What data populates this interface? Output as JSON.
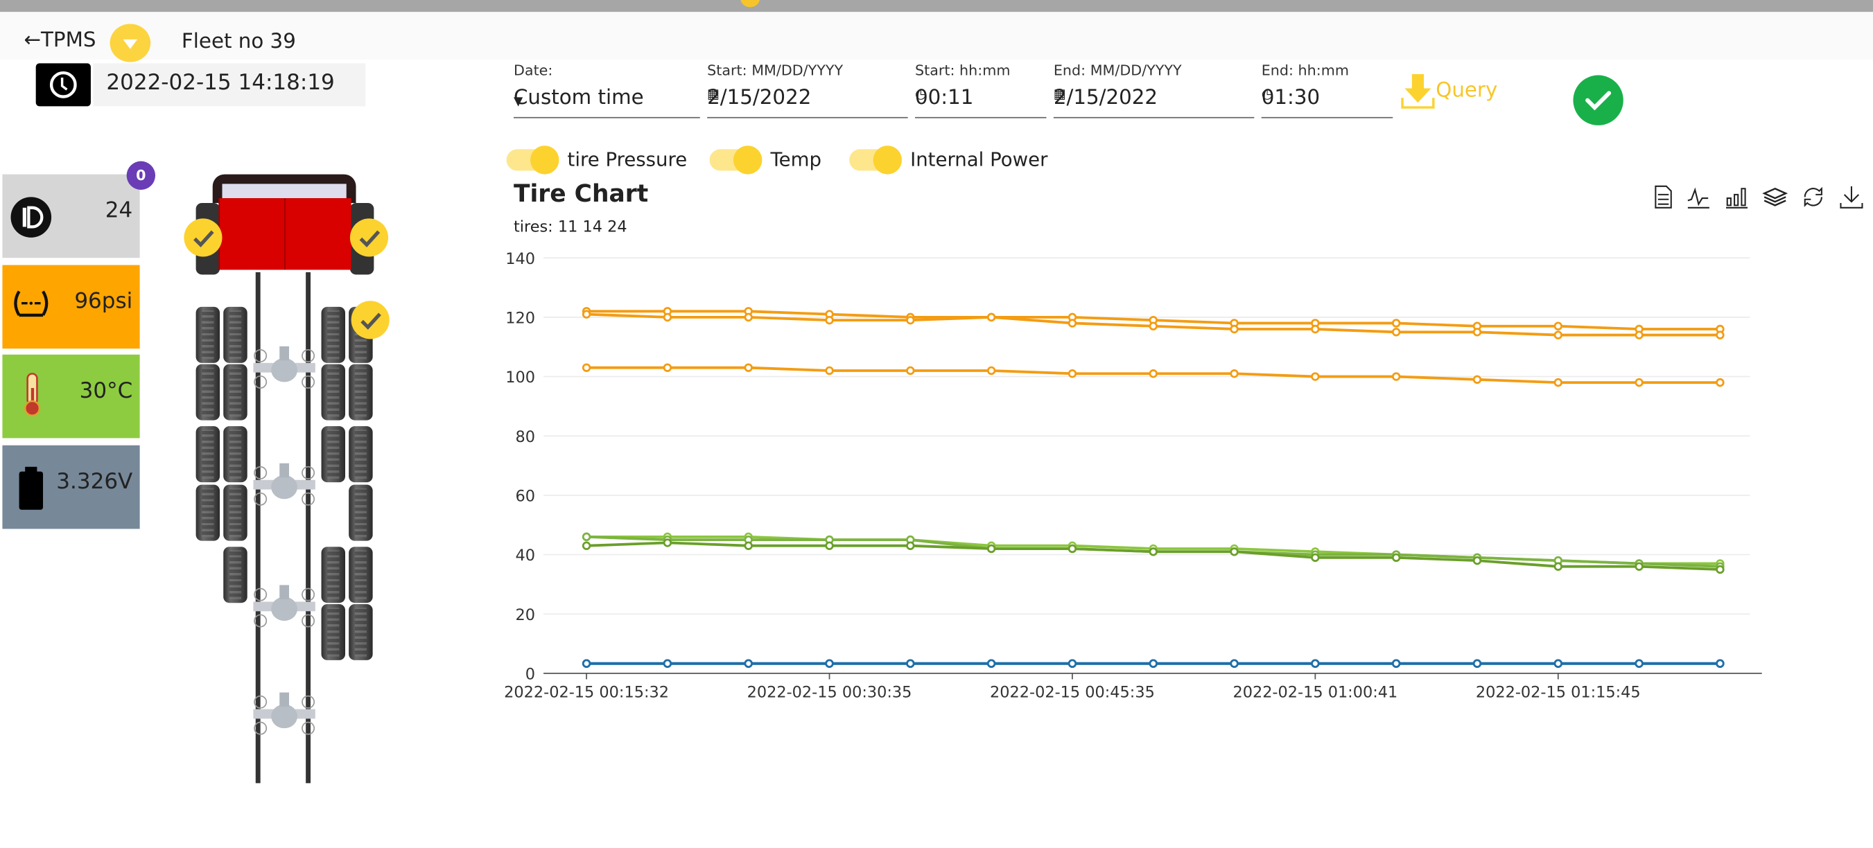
{
  "header": {
    "back_label": "TPMS",
    "fleet": "Fleet no 39",
    "datetime": "2022-02-15 14:18:19"
  },
  "sensor": {
    "badge_count": "0",
    "id": "24",
    "pressure": "96psi",
    "temp": "30°C",
    "voltage": "3.326V",
    "colors": {
      "id": "#d6d6d6",
      "pressure": "#ffa500",
      "temp": "#8dcc40",
      "voltage": "#778899"
    }
  },
  "filters": {
    "date": {
      "label": "Date:",
      "value": "Custom time"
    },
    "start_date": {
      "label": "Start: MM/DD/YYYY",
      "value": "2/15/2022"
    },
    "start_time": {
      "label": "Start: hh:mm",
      "value": "00:11"
    },
    "end_date": {
      "label": "End: MM/DD/YYYY",
      "value": "2/15/2022"
    },
    "end_time": {
      "label": "End: hh:mm",
      "value": "01:30"
    },
    "query_label": "Query"
  },
  "toggles": [
    {
      "label": "tire Pressure",
      "on": true
    },
    {
      "label": "Temp",
      "on": true
    },
    {
      "label": "Internal Power",
      "on": true
    }
  ],
  "chart_title": "Tire Chart",
  "chart_subtitle": "tires: 11 14 24",
  "toolbox": [
    "data-view-icon",
    "line-chart-icon",
    "bar-chart-icon",
    "stack-icon",
    "restore-icon",
    "save-image-icon"
  ],
  "chart_data": {
    "type": "line",
    "ylim": [
      0,
      140
    ],
    "y_ticks": [
      0,
      20,
      40,
      60,
      80,
      100,
      120,
      140
    ],
    "grid": true,
    "x_tick_labels": [
      {
        "index": 0,
        "label": "2022-02-15 00:15:32"
      },
      {
        "index": 3,
        "label": "2022-02-15 00:30:35"
      },
      {
        "index": 6,
        "label": "2022-02-15 00:45:35"
      },
      {
        "index": 9,
        "label": "2022-02-15 01:00:41"
      },
      {
        "index": 12,
        "label": "2022-02-15 01:15:45"
      }
    ],
    "point_count": 15,
    "series": [
      {
        "group": "pressure",
        "color": "#f39c12",
        "values": [
          122,
          122,
          122,
          121,
          120,
          120,
          120,
          119,
          118,
          118,
          118,
          117,
          117,
          116,
          116
        ]
      },
      {
        "group": "pressure",
        "color": "#f39c12",
        "values": [
          121,
          120,
          120,
          119,
          119,
          120,
          118,
          117,
          116,
          116,
          115,
          115,
          114,
          114,
          114
        ]
      },
      {
        "group": "pressure",
        "color": "#f39c12",
        "values": [
          103,
          103,
          103,
          102,
          102,
          102,
          101,
          101,
          101,
          100,
          100,
          99,
          98,
          98,
          98
        ]
      },
      {
        "group": "temp",
        "color": "#8cc63f",
        "values": [
          46,
          46,
          46,
          45,
          45,
          43,
          43,
          42,
          42,
          41,
          40,
          39,
          38,
          37,
          37
        ]
      },
      {
        "group": "temp",
        "color": "#7cb342",
        "values": [
          46,
          45,
          45,
          45,
          45,
          42,
          42,
          41,
          41,
          40,
          40,
          39,
          38,
          37,
          36
        ]
      },
      {
        "group": "temp",
        "color": "#6a9f2a",
        "values": [
          43,
          44,
          43,
          43,
          43,
          42,
          42,
          41,
          41,
          39,
          39,
          38,
          36,
          36,
          35
        ]
      },
      {
        "group": "power",
        "color": "#1f6fa8",
        "values": [
          3.3,
          3.3,
          3.3,
          3.3,
          3.3,
          3.3,
          3.3,
          3.3,
          3.3,
          3.3,
          3.3,
          3.3,
          3.3,
          3.3,
          3.3
        ]
      },
      {
        "group": "power",
        "color": "#1f6fa8",
        "values": [
          3.3,
          3.3,
          3.3,
          3.3,
          3.3,
          3.3,
          3.3,
          3.3,
          3.3,
          3.3,
          3.3,
          3.3,
          3.3,
          3.3,
          3.3
        ]
      },
      {
        "group": "power",
        "color": "#1f6fa8",
        "values": [
          3.3,
          3.3,
          3.3,
          3.3,
          3.3,
          3.3,
          3.3,
          3.3,
          3.3,
          3.3,
          3.3,
          3.3,
          3.3,
          3.3,
          3.3
        ]
      }
    ]
  }
}
